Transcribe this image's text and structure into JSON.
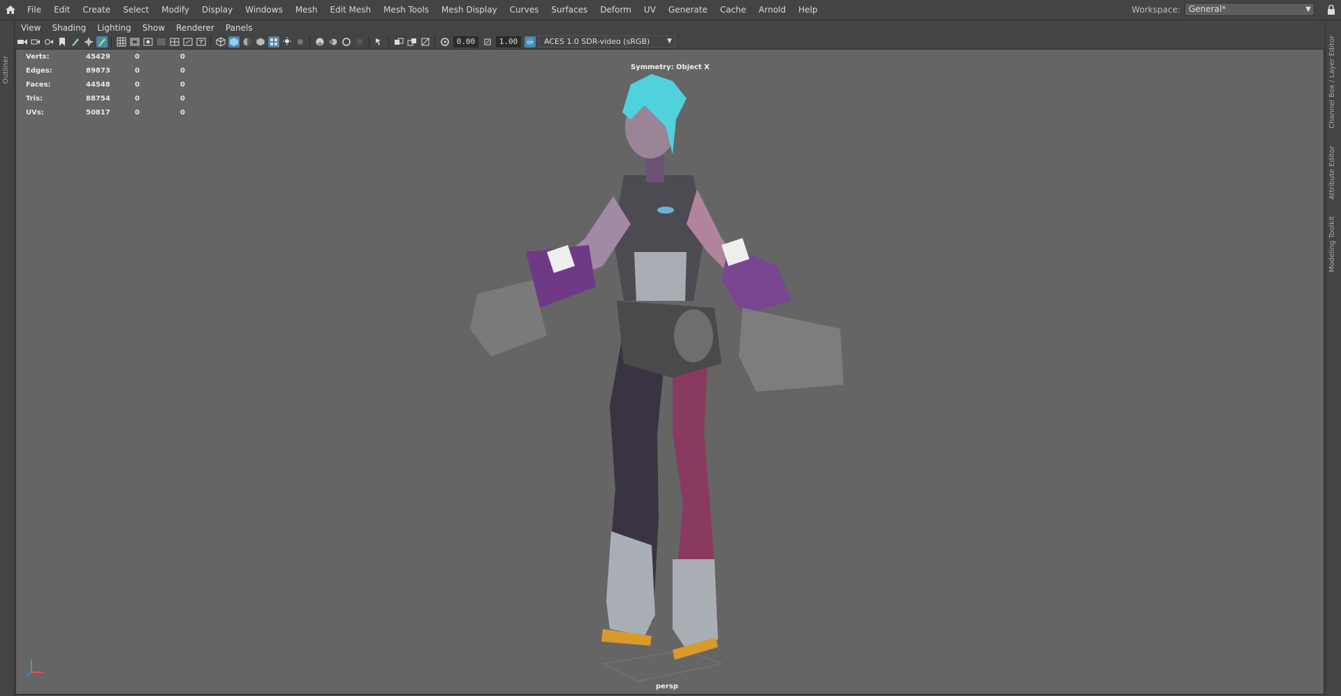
{
  "menubar": {
    "items": [
      "File",
      "Edit",
      "Create",
      "Select",
      "Modify",
      "Display",
      "Windows",
      "Mesh",
      "Edit Mesh",
      "Mesh Tools",
      "Mesh Display",
      "Curves",
      "Surfaces",
      "Deform",
      "UV",
      "Generate",
      "Cache",
      "Arnold",
      "Help"
    ],
    "workspace_label": "Workspace:",
    "workspace_value": "General*"
  },
  "left_strip": {
    "tab": "Outliner"
  },
  "right_strip": {
    "tabs": [
      "Channel Box / Layer Editor",
      "Attribute Editor",
      "Modeling Toolkit"
    ]
  },
  "panel_menu": {
    "items": [
      "View",
      "Shading",
      "Lighting",
      "Show",
      "Renderer",
      "Panels"
    ]
  },
  "toolbar": {
    "exposure": "0.00",
    "gamma": "1.00",
    "colorspace": "ACES 1.0 SDR-video (sRGB)"
  },
  "hud": {
    "rows": [
      {
        "label": "Verts:",
        "value": "45429",
        "a": "0",
        "b": "0"
      },
      {
        "label": "Edges:",
        "value": "89873",
        "a": "0",
        "b": "0"
      },
      {
        "label": "Faces:",
        "value": "44548",
        "a": "0",
        "b": "0"
      },
      {
        "label": "Tris:",
        "value": "88754",
        "a": "0",
        "b": "0"
      },
      {
        "label": "UVs:",
        "value": "50817",
        "a": "0",
        "b": "0"
      }
    ],
    "symmetry": "Symmetry: Object X",
    "camera": "persp"
  },
  "colors": {
    "accent": "#5285a6",
    "viewport_bg": "#656565",
    "panel_bg": "#444444"
  }
}
